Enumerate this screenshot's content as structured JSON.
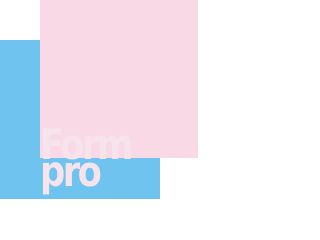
{
  "logo": {
    "line1": "Form",
    "line2": "pro",
    "colors": {
      "blue": "#6fc4ef",
      "pink": "#f9d9e6",
      "text": "#f7e3ec",
      "background": "#ffffff"
    }
  }
}
